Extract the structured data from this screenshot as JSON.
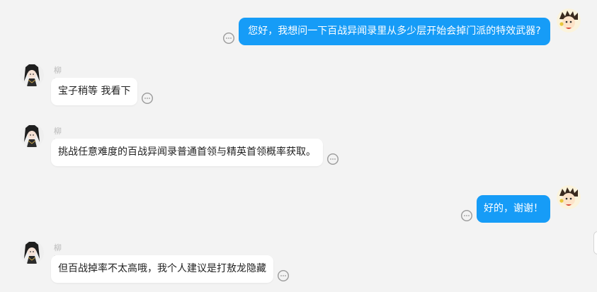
{
  "conversation": {
    "messages": [
      {
        "role": "user",
        "text": "您好，我想问一下百战异闻录里从多少层开始会掉门派的特效武器?"
      },
      {
        "role": "agent",
        "sender": "柳西月",
        "text": "宝子稍等 我看下"
      },
      {
        "role": "agent",
        "sender": "柳西月",
        "text": "挑战任意难度的百战异闻录普通首领与精英首领概率获取。"
      },
      {
        "role": "user",
        "text": "好的，谢谢！"
      },
      {
        "role": "agent",
        "sender": "柳西月",
        "text": "但百战掉率不太高哦，我个人建议是打敖龙隐藏"
      }
    ]
  },
  "icons": {
    "message_action": "comment-bubble-icon",
    "agent_avatar": "anime-character-avatar",
    "user_avatar": "user-avatar"
  },
  "colors": {
    "background": "#f3f3f3",
    "user_bubble": "#169cf7",
    "agent_bubble": "#ffffff",
    "sender_name": "#b8b8b8"
  }
}
